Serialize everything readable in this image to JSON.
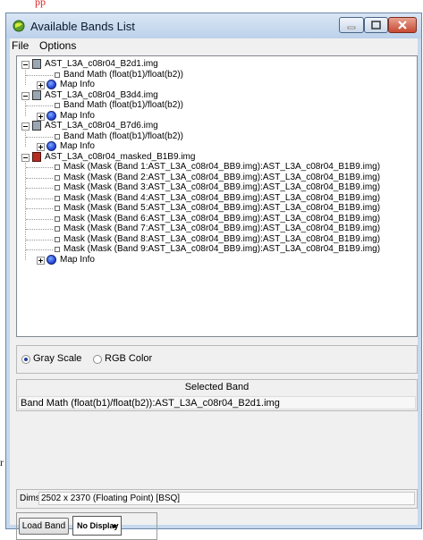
{
  "background_text": {
    "top": "pp",
    "left_fragment": "r"
  },
  "window": {
    "title": "Available Bands List",
    "title_icon": "envi-globe-icon",
    "controls": [
      "minimize",
      "maximize",
      "close"
    ]
  },
  "menu": [
    "File",
    "Options"
  ],
  "tree": {
    "files": [
      {
        "name": "AST_L3A_c08r04_B2d1.img",
        "bands": [
          "Band Math (float(b1)/float(b2))"
        ],
        "map_info": "Map Info"
      },
      {
        "name": "AST_L3A_c08r04_B3d4.img",
        "bands": [
          "Band Math (float(b1)/float(b2))"
        ],
        "map_info": "Map Info"
      },
      {
        "name": "AST_L3A_c08r04_B7d6.img",
        "bands": [
          "Band Math (float(b1)/float(b2))"
        ],
        "map_info": "Map Info"
      },
      {
        "name": "AST_L3A_c08r04_masked_B1B9.img",
        "bands": [
          "Mask (Mask (Band 1:AST_L3A_c08r04_BB9.img):AST_L3A_c08r04_B1B9.img)",
          "Mask (Mask (Band 2:AST_L3A_c08r04_BB9.img):AST_L3A_c08r04_B1B9.img)",
          "Mask (Mask (Band 3:AST_L3A_c08r04_BB9.img):AST_L3A_c08r04_B1B9.img)",
          "Mask (Mask (Band 4:AST_L3A_c08r04_BB9.img):AST_L3A_c08r04_B1B9.img)",
          "Mask (Mask (Band 5:AST_L3A_c08r04_BB9.img):AST_L3A_c08r04_B1B9.img)",
          "Mask (Mask (Band 6:AST_L3A_c08r04_BB9.img):AST_L3A_c08r04_B1B9.img)",
          "Mask (Mask (Band 7:AST_L3A_c08r04_BB9.img):AST_L3A_c08r04_B1B9.img)",
          "Mask (Mask (Band 8:AST_L3A_c08r04_BB9.img):AST_L3A_c08r04_B1B9.img)",
          "Mask (Mask (Band 9:AST_L3A_c08r04_BB9.img):AST_L3A_c08r04_B1B9.img)"
        ],
        "map_info": "Map Info"
      }
    ]
  },
  "display_mode": {
    "gray_label": "Gray Scale",
    "rgb_label": "RGB Color",
    "selected": "gray"
  },
  "selected_band": {
    "title": "Selected Band",
    "value": "Band Math (float(b1)/float(b2)):AST_L3A_c08r04_B2d1.img"
  },
  "dims": {
    "label": "Dims",
    "value": "2502 x 2370 (Floating Point) [BSQ]"
  },
  "actions": {
    "load_band": "Load Band",
    "display": "No Display"
  },
  "colors": {
    "title_bar": "#c6d9ee",
    "close_button": "#c74a32",
    "client_bg": "#f0f0f0"
  }
}
